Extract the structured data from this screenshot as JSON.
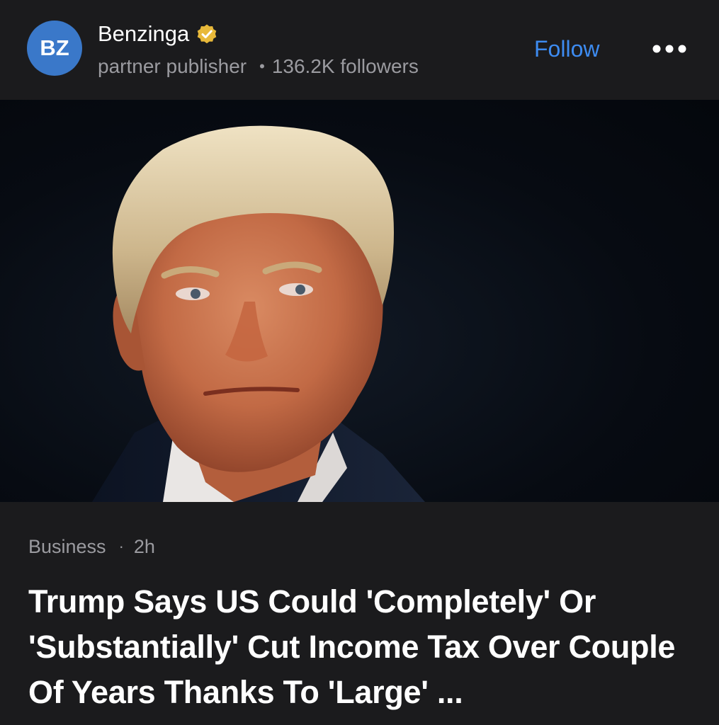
{
  "publisher": {
    "avatar_initials": "BZ",
    "avatar_color": "#3a78c9",
    "name": "Benzinga",
    "verified_icon": "verified-badge-icon",
    "verified_color": "#e8b93a",
    "role": "partner publisher",
    "separator": "•",
    "followers": "136.2K followers"
  },
  "actions": {
    "follow_label": "Follow",
    "follow_color": "#3d8bf0",
    "more_icon": "more-horizontal-icon"
  },
  "article": {
    "image_alt": "Portrait photo",
    "category": "Business",
    "meta_separator": "·",
    "age": "2h",
    "headline": "Trump Says US Could 'Completely' Or 'Substantially' Cut Income Tax Over Couple Of Years Thanks To 'Large' ..."
  }
}
